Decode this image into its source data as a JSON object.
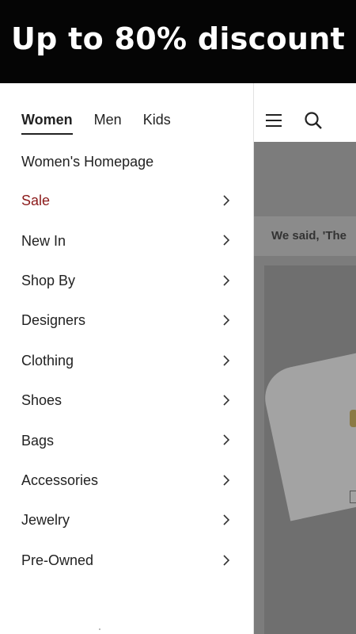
{
  "banner": {
    "text": "Up to 80% discount"
  },
  "drawer": {
    "tabs": [
      {
        "label": "Women",
        "active": true
      },
      {
        "label": "Men",
        "active": false
      },
      {
        "label": "Kids",
        "active": false
      }
    ],
    "homepage_link": "Women's Homepage",
    "items": [
      {
        "label": "Sale",
        "highlight": true
      },
      {
        "label": "New In"
      },
      {
        "label": "Shop By"
      },
      {
        "label": "Designers"
      },
      {
        "label": "Clothing"
      },
      {
        "label": "Shoes"
      },
      {
        "label": "Bags"
      },
      {
        "label": "Accessories"
      },
      {
        "label": "Jewelry"
      },
      {
        "label": "Pre-Owned"
      }
    ]
  },
  "background": {
    "promo_text": "We said, 'The",
    "icons": [
      "menu-icon",
      "search-icon"
    ]
  },
  "colors": {
    "sale": "#8b1a1a",
    "banner_bg": "#050505",
    "overlay": "#7c7c7c"
  }
}
